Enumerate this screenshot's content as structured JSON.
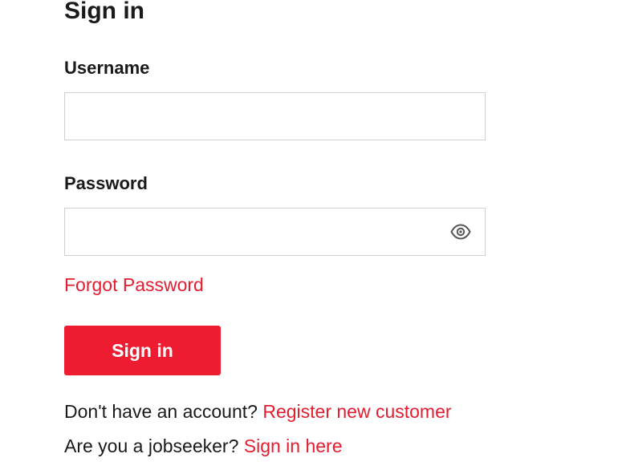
{
  "page": {
    "title": "Sign in"
  },
  "form": {
    "username": {
      "label": "Username",
      "value": "",
      "placeholder": ""
    },
    "password": {
      "label": "Password",
      "value": "",
      "placeholder": "",
      "toggle_icon": "eye-icon"
    },
    "forgot_password_label": "Forgot Password",
    "submit_label": "Sign in"
  },
  "footer": {
    "register_prompt": "Don't have an account?",
    "register_link": "Register new customer",
    "jobseeker_prompt": "Are you a jobseeker?",
    "jobseeker_link": "Sign in here"
  },
  "colors": {
    "accent": "#ee1c30",
    "link": "#e31c2f",
    "text": "#1a1a1a",
    "border": "#cfcfcf"
  }
}
